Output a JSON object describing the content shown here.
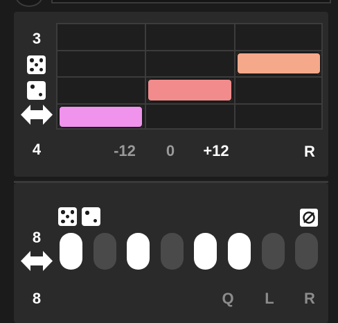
{
  "pitch_panel": {
    "row_count": "3",
    "octave_value": "4",
    "x_labels": [
      "-12",
      "0",
      "+12"
    ],
    "reset_label": "R",
    "rows": 4,
    "cols": 3,
    "blocks": [
      {
        "name": "block-high-random",
        "row": 1,
        "col": 2,
        "color": "#f5a98a"
      },
      {
        "name": "block-mid-random",
        "row": 2,
        "col": 1,
        "color": "#f28c8c"
      },
      {
        "name": "block-low-shift",
        "row": 3,
        "col": 0,
        "color": "#ef93ec"
      }
    ],
    "row_icons": [
      "five-dice-icon",
      "two-dice-icon",
      "horizontal-arrows-icon"
    ]
  },
  "rhythm_panel": {
    "steps_value": "8",
    "length_value": "8",
    "bottom_labels": [
      "Q",
      "L",
      "R"
    ],
    "steps": [
      true,
      false,
      true,
      false,
      true,
      true,
      false,
      false
    ],
    "icons": [
      "five-dice-icon",
      "two-dice-icon",
      "no-entry-icon",
      "horizontal-arrows-icon"
    ]
  },
  "colors": {
    "background": "#1b1b1b",
    "panel": "#2a2a2a",
    "grid_line": "#3c3c3c",
    "step_on": "#ffffff",
    "step_off": "#4a4a4a"
  }
}
